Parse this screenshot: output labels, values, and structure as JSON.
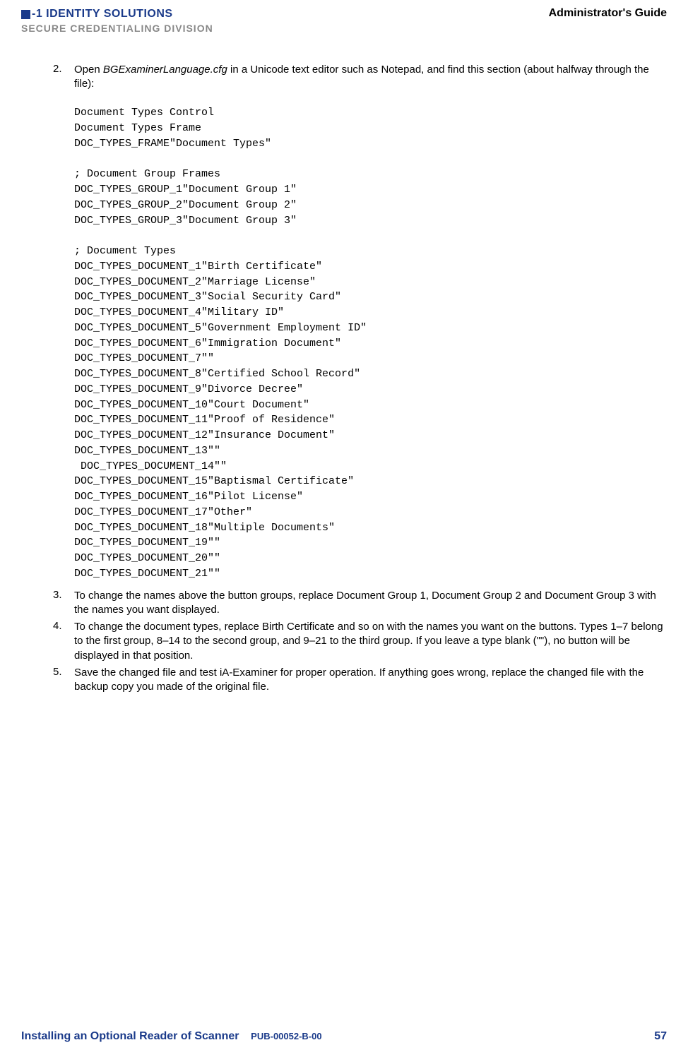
{
  "header": {
    "logo_line1": "-1 IDENTITY SOLUTIONS",
    "logo_line2": "SECURE CREDENTIALING DIVISION",
    "guide": "Administrator's Guide"
  },
  "items": {
    "2": {
      "num": "2.",
      "text_pre": "Open ",
      "text_italic": "BGExaminerLanguage.cfg",
      "text_post": " in a Unicode text editor such as Notepad, and find this section (about halfway through the file):"
    },
    "3": {
      "num": "3.",
      "text": "To change the names above the button groups, replace Document Group 1, Document Group 2 and Document Group 3 with the names you want displayed."
    },
    "4": {
      "num": "4.",
      "text": "To change the document types, replace Birth Certificate and so on with the names you want on the buttons. Types 1–7 belong to the first group, 8–14 to the second group, and 9–21 to the third group. If you leave a type blank (\"\"), no button will be displayed in that position."
    },
    "5": {
      "num": "5.",
      "text": "Save the changed file and test iA-Examiner for proper operation. If anything goes wrong, replace the changed file with the backup copy you made of the original file."
    }
  },
  "code": "Document Types Control\nDocument Types Frame\nDOC_TYPES_FRAME\"Document Types\"\n\n; Document Group Frames\nDOC_TYPES_GROUP_1\"Document Group 1\"\nDOC_TYPES_GROUP_2\"Document Group 2\"\nDOC_TYPES_GROUP_3\"Document Group 3\"\n\n; Document Types\nDOC_TYPES_DOCUMENT_1\"Birth Certificate\"\nDOC_TYPES_DOCUMENT_2\"Marriage License\"\nDOC_TYPES_DOCUMENT_3\"Social Security Card\"\nDOC_TYPES_DOCUMENT_4\"Military ID\"\nDOC_TYPES_DOCUMENT_5\"Government Employment ID\"\nDOC_TYPES_DOCUMENT_6\"Immigration Document\"\nDOC_TYPES_DOCUMENT_7\"\"\nDOC_TYPES_DOCUMENT_8\"Certified School Record\"\nDOC_TYPES_DOCUMENT_9\"Divorce Decree\"\nDOC_TYPES_DOCUMENT_10\"Court Document\"\nDOC_TYPES_DOCUMENT_11\"Proof of Residence\"\nDOC_TYPES_DOCUMENT_12\"Insurance Document\"\nDOC_TYPES_DOCUMENT_13\"\"\n DOC_TYPES_DOCUMENT_14\"\"\nDOC_TYPES_DOCUMENT_15\"Baptismal Certificate\"\nDOC_TYPES_DOCUMENT_16\"Pilot License\"\nDOC_TYPES_DOCUMENT_17\"Other\"\nDOC_TYPES_DOCUMENT_18\"Multiple Documents\"\nDOC_TYPES_DOCUMENT_19\"\"\nDOC_TYPES_DOCUMENT_20\"\"\nDOC_TYPES_DOCUMENT_21\"\"",
  "footer": {
    "section": "Installing an Optional Reader of Scanner",
    "pub": "PUB-00052-B-00",
    "page": "57"
  }
}
